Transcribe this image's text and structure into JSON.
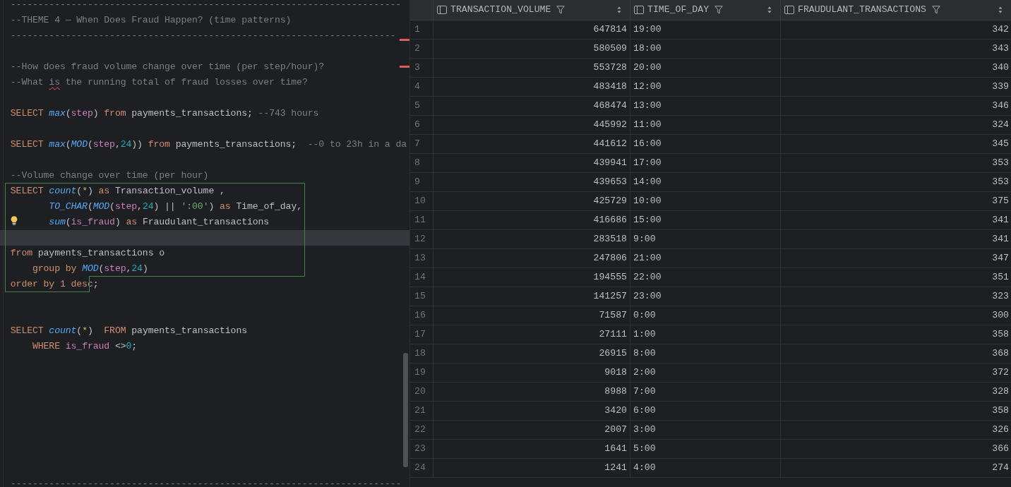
{
  "editor": {
    "lines": [
      {
        "kind": "code",
        "current": false,
        "bulb": false,
        "tokens": [
          {
            "kind": "comment",
            "text": "-----------------------------------------------------------------------"
          }
        ]
      },
      {
        "kind": "code",
        "current": false,
        "bulb": false,
        "tokens": [
          {
            "kind": "comment",
            "text": "--THEME 4 — When Does Fraud Happen? (time patterns)"
          }
        ]
      },
      {
        "kind": "code",
        "current": false,
        "bulb": false,
        "tokens": [
          {
            "kind": "comment",
            "text": "----------------------------------------------------------------------"
          }
        ]
      },
      {
        "kind": "blank",
        "current": false,
        "bulb": false
      },
      {
        "kind": "code",
        "current": false,
        "bulb": false,
        "tokens": [
          {
            "kind": "comment",
            "text": "--How does fraud volume change over time (per step/hour)?"
          }
        ]
      },
      {
        "kind": "code",
        "current": false,
        "bulb": false,
        "tokens": [
          {
            "kind": "comment",
            "text": "--What "
          },
          {
            "kind": "typo",
            "text": "is"
          },
          {
            "kind": "comment",
            "text": " the running total of fraud losses over time?"
          }
        ]
      },
      {
        "kind": "blank",
        "current": false,
        "bulb": false
      },
      {
        "kind": "code",
        "current": false,
        "bulb": false,
        "tokens": [
          {
            "kind": "keyword",
            "text": "SELECT "
          },
          {
            "kind": "function",
            "text": "max"
          },
          {
            "kind": "plain",
            "text": "("
          },
          {
            "kind": "column",
            "text": "step"
          },
          {
            "kind": "plain",
            "text": ") "
          },
          {
            "kind": "keyword",
            "text": "from "
          },
          {
            "kind": "plain",
            "text": "payments_transactions; "
          },
          {
            "kind": "comment",
            "text": "--743 hours"
          }
        ]
      },
      {
        "kind": "blank",
        "current": false,
        "bulb": false
      },
      {
        "kind": "code",
        "current": false,
        "bulb": false,
        "tokens": [
          {
            "kind": "keyword",
            "text": "SELECT "
          },
          {
            "kind": "function",
            "text": "max"
          },
          {
            "kind": "plain",
            "text": "("
          },
          {
            "kind": "function",
            "text": "MOD"
          },
          {
            "kind": "plain",
            "text": "("
          },
          {
            "kind": "column",
            "text": "step"
          },
          {
            "kind": "plain",
            "text": ","
          },
          {
            "kind": "number",
            "text": "24"
          },
          {
            "kind": "plain",
            "text": ")) "
          },
          {
            "kind": "keyword",
            "text": "from "
          },
          {
            "kind": "plain",
            "text": "payments_transactions;  "
          },
          {
            "kind": "comment",
            "text": "--0 to 23h in a da"
          }
        ]
      },
      {
        "kind": "blank",
        "current": false,
        "bulb": false
      },
      {
        "kind": "code",
        "current": false,
        "bulb": false,
        "tokens": [
          {
            "kind": "comment",
            "text": "--Volume change over time (per hour)"
          }
        ]
      },
      {
        "kind": "code",
        "current": false,
        "bulb": false,
        "tokens": [
          {
            "kind": "keyword",
            "text": "SELECT "
          },
          {
            "kind": "function",
            "text": "count"
          },
          {
            "kind": "plain",
            "text": "("
          },
          {
            "kind": "star",
            "text": "*"
          },
          {
            "kind": "plain",
            "text": ") "
          },
          {
            "kind": "keyword",
            "text": "as "
          },
          {
            "kind": "plain",
            "text": "Transaction_volume ,"
          }
        ]
      },
      {
        "kind": "code",
        "current": false,
        "bulb": false,
        "tokens": [
          {
            "kind": "function",
            "text": "       TO_CHAR"
          },
          {
            "kind": "plain",
            "text": "("
          },
          {
            "kind": "function",
            "text": "MOD"
          },
          {
            "kind": "plain",
            "text": "("
          },
          {
            "kind": "column",
            "text": "step"
          },
          {
            "kind": "plain",
            "text": ","
          },
          {
            "kind": "number",
            "text": "24"
          },
          {
            "kind": "plain",
            "text": ") || "
          },
          {
            "kind": "string",
            "text": "':00'"
          },
          {
            "kind": "plain",
            "text": ") "
          },
          {
            "kind": "keyword",
            "text": "as "
          },
          {
            "kind": "plain",
            "text": "Time_of_day,"
          }
        ]
      },
      {
        "kind": "code",
        "current": false,
        "bulb": true,
        "tokens": [
          {
            "kind": "function",
            "text": "       sum"
          },
          {
            "kind": "plain",
            "text": "("
          },
          {
            "kind": "column",
            "text": "is_fraud"
          },
          {
            "kind": "plain",
            "text": ") "
          },
          {
            "kind": "keyword",
            "text": "as "
          },
          {
            "kind": "plain",
            "text": "Fraudulant_transactions"
          }
        ]
      },
      {
        "kind": "blank",
        "current": true,
        "bulb": false
      },
      {
        "kind": "code",
        "current": false,
        "bulb": false,
        "tokens": [
          {
            "kind": "keyword",
            "text": "from "
          },
          {
            "kind": "plain",
            "text": "payments_transactions o"
          }
        ]
      },
      {
        "kind": "code",
        "current": false,
        "bulb": false,
        "tokens": [
          {
            "kind": "keyword",
            "text": "    group by "
          },
          {
            "kind": "function",
            "text": "MOD"
          },
          {
            "kind": "plain",
            "text": "("
          },
          {
            "kind": "column",
            "text": "step"
          },
          {
            "kind": "plain",
            "text": ","
          },
          {
            "kind": "number",
            "text": "24"
          },
          {
            "kind": "plain",
            "text": ")"
          }
        ]
      },
      {
        "kind": "code",
        "current": false,
        "bulb": false,
        "tokens": [
          {
            "kind": "keyword",
            "text": "order by 1 desc"
          },
          {
            "kind": "plain",
            "text": ";"
          }
        ]
      },
      {
        "kind": "blank",
        "current": false,
        "bulb": false
      },
      {
        "kind": "blank",
        "current": false,
        "bulb": false
      },
      {
        "kind": "code",
        "current": false,
        "bulb": false,
        "tokens": [
          {
            "kind": "keyword",
            "text": "SELECT "
          },
          {
            "kind": "function",
            "text": "count"
          },
          {
            "kind": "plain",
            "text": "("
          },
          {
            "kind": "star",
            "text": "*"
          },
          {
            "kind": "plain",
            "text": ")  "
          },
          {
            "kind": "keyword",
            "text": "FROM "
          },
          {
            "kind": "plain",
            "text": "payments_transactions"
          }
        ]
      },
      {
        "kind": "code",
        "current": false,
        "bulb": false,
        "tokens": [
          {
            "kind": "keyword",
            "text": "    WHERE "
          },
          {
            "kind": "column",
            "text": "is_fraud"
          },
          {
            "kind": "plain",
            "text": " <>"
          },
          {
            "kind": "number",
            "text": "0"
          },
          {
            "kind": "plain",
            "text": ";"
          }
        ]
      },
      {
        "kind": "blank",
        "current": false,
        "bulb": false
      },
      {
        "kind": "blank",
        "current": false,
        "bulb": false
      },
      {
        "kind": "blank",
        "current": false,
        "bulb": false
      },
      {
        "kind": "blank",
        "current": false,
        "bulb": false
      },
      {
        "kind": "blank",
        "current": false,
        "bulb": false
      },
      {
        "kind": "blank",
        "current": false,
        "bulb": false
      },
      {
        "kind": "blank",
        "current": false,
        "bulb": false
      },
      {
        "kind": "blank",
        "current": false,
        "bulb": false
      },
      {
        "kind": "code",
        "current": false,
        "bulb": false,
        "tokens": [
          {
            "kind": "comment",
            "text": "-----------------------------------------------------------------------"
          }
        ]
      }
    ]
  },
  "results": {
    "columns": [
      {
        "label": "TRANSACTION_VOLUME",
        "kind": "number"
      },
      {
        "label": "TIME_OF_DAY",
        "kind": "text"
      },
      {
        "label": "FRAUDULANT_TRANSACTIONS",
        "kind": "number"
      }
    ],
    "rows": [
      {
        "number": "1",
        "cells": [
          "647814",
          "19:00",
          "342"
        ]
      },
      {
        "number": "2",
        "cells": [
          "580509",
          "18:00",
          "343"
        ]
      },
      {
        "number": "3",
        "cells": [
          "553728",
          "20:00",
          "340"
        ]
      },
      {
        "number": "4",
        "cells": [
          "483418",
          "12:00",
          "339"
        ]
      },
      {
        "number": "5",
        "cells": [
          "468474",
          "13:00",
          "346"
        ]
      },
      {
        "number": "6",
        "cells": [
          "445992",
          "11:00",
          "324"
        ]
      },
      {
        "number": "7",
        "cells": [
          "441612",
          "16:00",
          "345"
        ]
      },
      {
        "number": "8",
        "cells": [
          "439941",
          "17:00",
          "353"
        ]
      },
      {
        "number": "9",
        "cells": [
          "439653",
          "14:00",
          "353"
        ]
      },
      {
        "number": "10",
        "cells": [
          "425729",
          "10:00",
          "375"
        ]
      },
      {
        "number": "11",
        "cells": [
          "416686",
          "15:00",
          "341"
        ]
      },
      {
        "number": "12",
        "cells": [
          "283518",
          "9:00",
          "341"
        ]
      },
      {
        "number": "13",
        "cells": [
          "247806",
          "21:00",
          "347"
        ]
      },
      {
        "number": "14",
        "cells": [
          "194555",
          "22:00",
          "351"
        ]
      },
      {
        "number": "15",
        "cells": [
          "141257",
          "23:00",
          "323"
        ]
      },
      {
        "number": "16",
        "cells": [
          "71587",
          "0:00",
          "300"
        ]
      },
      {
        "number": "17",
        "cells": [
          "27111",
          "1:00",
          "358"
        ]
      },
      {
        "number": "18",
        "cells": [
          "26915",
          "8:00",
          "368"
        ]
      },
      {
        "number": "19",
        "cells": [
          "9018",
          "2:00",
          "372"
        ]
      },
      {
        "number": "20",
        "cells": [
          "8988",
          "7:00",
          "328"
        ]
      },
      {
        "number": "21",
        "cells": [
          "3420",
          "6:00",
          "358"
        ]
      },
      {
        "number": "22",
        "cells": [
          "2007",
          "3:00",
          "326"
        ]
      },
      {
        "number": "23",
        "cells": [
          "1641",
          "5:00",
          "366"
        ]
      },
      {
        "number": "24",
        "cells": [
          "1241",
          "4:00",
          "274"
        ]
      }
    ]
  }
}
